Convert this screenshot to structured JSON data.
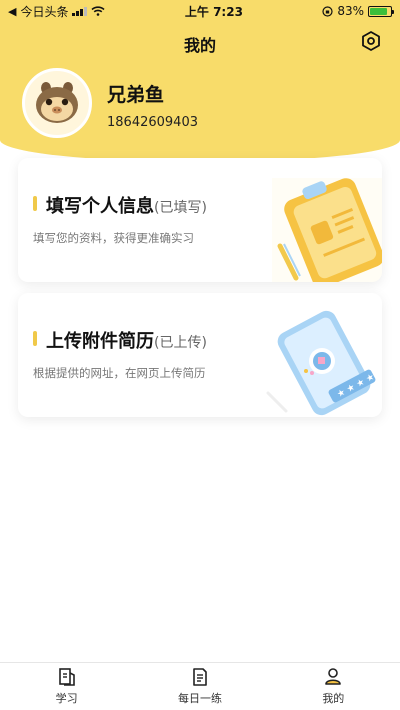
{
  "status_bar": {
    "back_app": "今日头条",
    "time": "上午 7:23",
    "battery": "83%",
    "battery_level": 0.83
  },
  "header": {
    "title": "我的"
  },
  "user": {
    "name": "兄弟鱼",
    "phone": "18642609403"
  },
  "cards": [
    {
      "title": "填写个人信息",
      "status": "(已填写)",
      "description": "填写您的资料，获得更准确实习"
    },
    {
      "title": "上传附件简历",
      "status": "(已上传)",
      "description": "根据提供的网址，在网页上传简历"
    }
  ],
  "tabs": [
    {
      "label": "学习",
      "icon": "book-icon"
    },
    {
      "label": "每日一练",
      "icon": "document-icon"
    },
    {
      "label": "我的",
      "icon": "user-icon",
      "active": true
    }
  ],
  "colors": {
    "accent": "#f8dc6a",
    "accent_dark": "#f0c94a",
    "text": "#111111",
    "muted": "#777777"
  }
}
